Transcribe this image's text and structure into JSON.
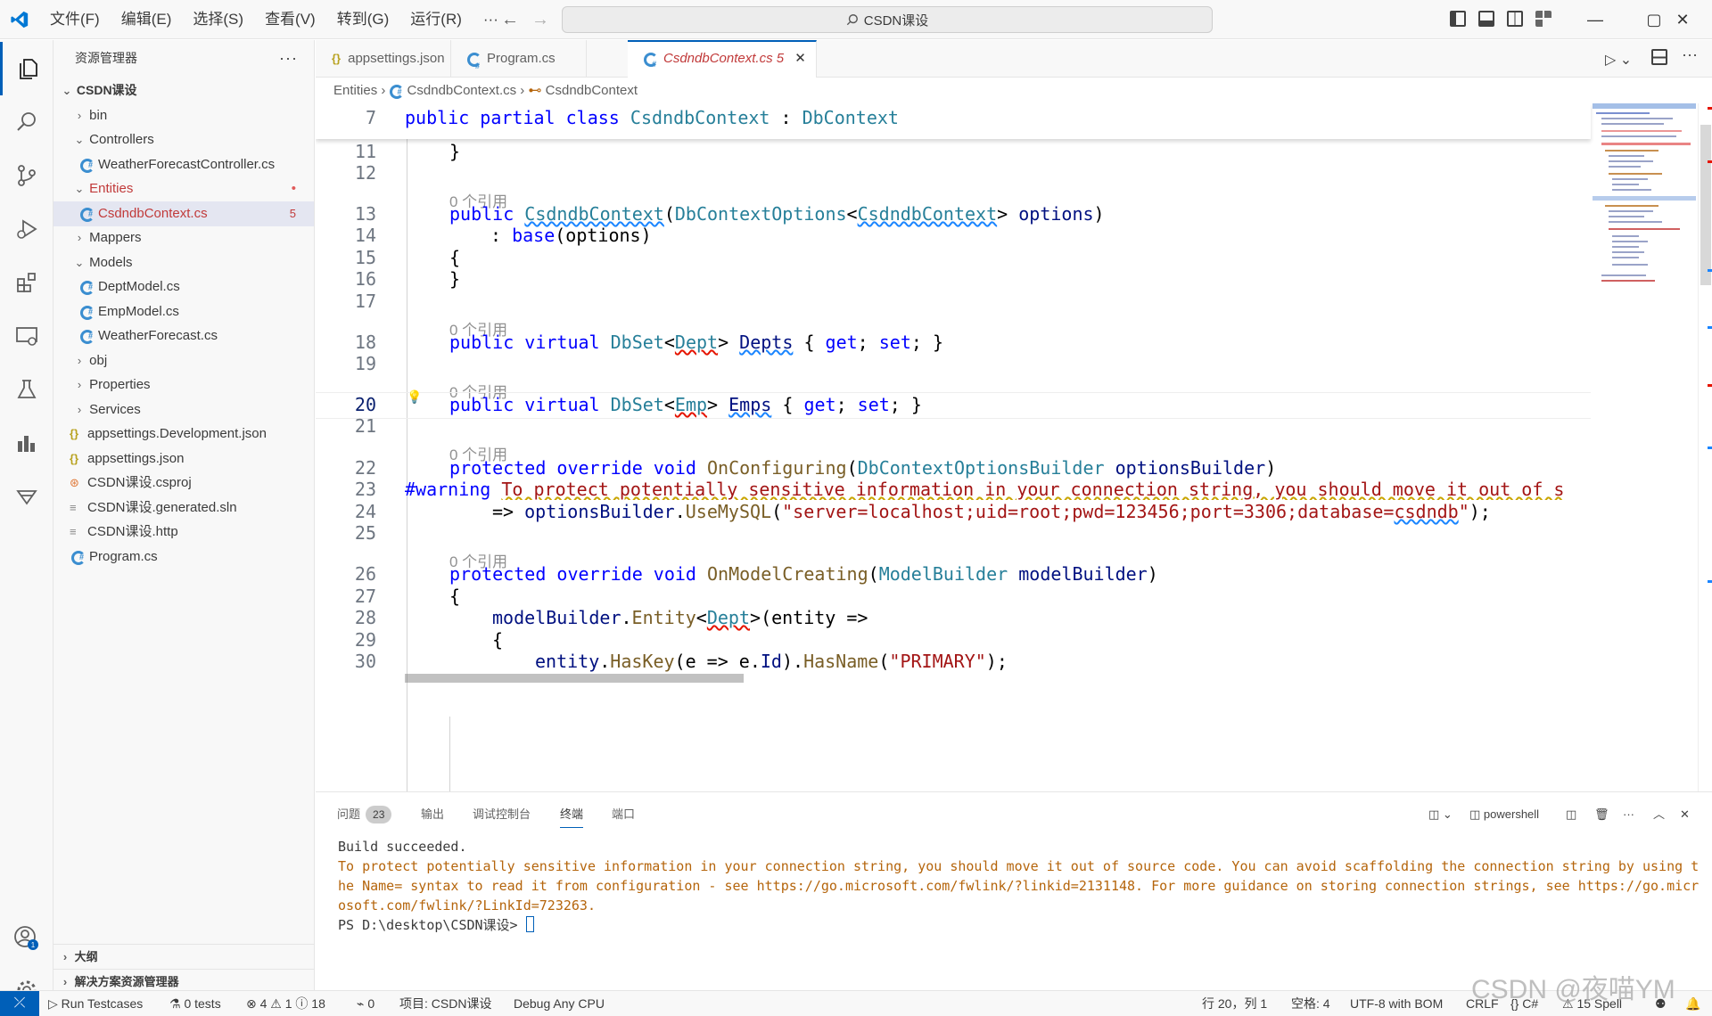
{
  "titlebar": {
    "menus": [
      "文件(F)",
      "编辑(E)",
      "选择(S)",
      "查看(V)",
      "转到(G)",
      "运行(R)"
    ],
    "more": "···",
    "search": "CSDN课设",
    "back": "←",
    "forward": "→",
    "minimize": "—",
    "maximize": "▢",
    "close": "✕"
  },
  "sidebar": {
    "title": "资源管理器",
    "more": "···",
    "root": "CSDN课设",
    "items": [
      {
        "label": "bin"
      },
      {
        "label": "Controllers"
      },
      {
        "label": "WeatherForecastController.cs"
      },
      {
        "label": "Entities",
        "badge": "•"
      },
      {
        "label": "CsdndbContext.cs",
        "badge": "5"
      },
      {
        "label": "Mappers"
      },
      {
        "label": "Models"
      },
      {
        "label": "DeptModel.cs"
      },
      {
        "label": "EmpModel.cs"
      },
      {
        "label": "WeatherForecast.cs"
      },
      {
        "label": "obj"
      },
      {
        "label": "Properties"
      },
      {
        "label": "Services"
      },
      {
        "label": "appsettings.Development.json"
      },
      {
        "label": "appsettings.json"
      },
      {
        "label": "CSDN课设.csproj"
      },
      {
        "label": "CSDN课设.generated.sln"
      },
      {
        "label": "CSDN课设.http"
      },
      {
        "label": "Program.cs"
      }
    ],
    "outline": "大纲",
    "solution": "解决方案资源管理器"
  },
  "tabs": [
    {
      "label": "appsettings.json"
    },
    {
      "label": "Program.cs"
    },
    {
      "label": "CsdndbContext.cs",
      "badge": "5",
      "close": "✕"
    }
  ],
  "breadcrumb": {
    "a": "Entities",
    "b": "CsdndbContext.cs",
    "c": "CsdndbContext"
  },
  "editor": {
    "refs": "0 个引用",
    "lines": {
      "l7": "7",
      "l10": "",
      "l11": "11",
      "l12": "12",
      "l13": "13",
      "l14": "14",
      "l15": "15",
      "l16": "16",
      "l17": "17",
      "l18": "18",
      "l19": "19",
      "l20": "20",
      "l21": "21",
      "l22": "22",
      "l23": "23",
      "l24": "24",
      "l25": "25",
      "l26": "26",
      "l27": "27",
      "l28": "28",
      "l29": "29",
      "l30": "30"
    }
  },
  "code": {
    "sticky": {
      "a": "public",
      "b": "partial",
      "c": "class",
      "d": "CsdndbContext",
      "e": ":",
      "f": "DbContext"
    },
    "l13": {
      "a": "public",
      "b": "CsdndbContext",
      "c": "(",
      "d": "DbContextOptions",
      "e": "<",
      "f": "CsdndbContext",
      "g": ">",
      "h": "options",
      "i": ")"
    },
    "l14": {
      "a": ": ",
      "b": "base",
      "c": "(options)"
    },
    "l18": {
      "a": "public",
      "b": "virtual",
      "c": "DbSet",
      "d": "Dept",
      "e": "Depts",
      "f": "{ ",
      "g": "get",
      "h": "; ",
      "i": "set",
      "j": "; }"
    },
    "l20": {
      "a": "public",
      "b": "virtual",
      "c": "DbSet",
      "d": "Emp",
      "e": "Emps",
      "f": "{ ",
      "g": "get",
      "h": "; ",
      "i": "set",
      "j": "; }"
    },
    "l22": {
      "a": "protected",
      "b": "override",
      "c": "void",
      "d": "OnConfiguring",
      "e": "DbContextOptionsBuilder",
      "f": "optionsBuilder"
    },
    "l23": {
      "a": "#warning",
      "b": "To protect potentially sensitive information in your connection string, you should move it out of s"
    },
    "l24": {
      "a": "=> ",
      "b": "optionsBuilder",
      "c": ".",
      "d": "UseMySQL",
      "e": "\"server=localhost;uid=root;pwd=123456;port=3306;database=",
      "f": "csdndb",
      "g": "\"",
      "h": ");"
    },
    "l26": {
      "a": "protected",
      "b": "override",
      "c": "void",
      "d": "OnModelCreating",
      "e": "ModelBuilder",
      "f": "modelBuilder"
    },
    "l28": {
      "a": "modelBuilder",
      "b": ".",
      "c": "Entity",
      "d": "Dept",
      "e": "(entity =>"
    },
    "l30": {
      "a": "entity",
      "b": "HasKey",
      "c": "(e => e.",
      "d": "Id",
      "e": ").",
      "f": "HasName",
      "g": "\"PRIMARY\"",
      "h": ");"
    }
  },
  "panel": {
    "tabs": {
      "problems": "问题",
      "problems_count": "23",
      "output": "输出",
      "debug": "调试控制台",
      "terminal": "终端",
      "ports": "端口"
    },
    "shell": "powershell",
    "terminal": {
      "line1": "Build succeeded.",
      "warning": "To protect potentially sensitive information in your connection string, you should move it out of source code. You can avoid scaffolding the connection string by using the Name= syntax to read it from configuration - see https://go.microsoft.com/fwlink/?linkid=2131148. For more guidance on storing connection strings, see https://go.microsoft.com/fwlink/?LinkId=723263.",
      "prompt": "PS D:\\desktop\\CSDN课设> "
    }
  },
  "statusbar": {
    "remote": "⤫",
    "run": "Run Testcases",
    "tests": "0 tests",
    "problems": "⊗ 4 ⚠ 1 ⓘ 18",
    "ports": "0",
    "project": "项目: CSDN课设",
    "config": "Debug Any CPU",
    "position": "行 20，列 1",
    "spaces": "空格: 4",
    "encoding": "UTF-8 with BOM",
    "eol": "CRLF",
    "lang": "{} C#",
    "spell": "⚠ 15 Spell"
  },
  "watermark": "CSDN @夜喵YM",
  "colors": {
    "accent": "#005fb8",
    "error": "#e51400",
    "keyword": "#0000ff",
    "type": "#267f99"
  }
}
